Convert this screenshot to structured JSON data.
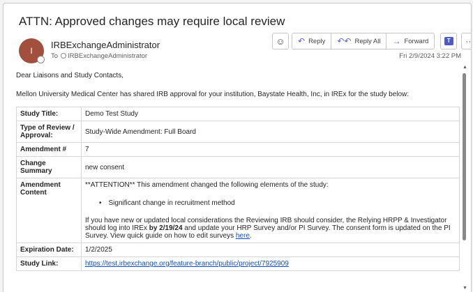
{
  "subject": "ATTN: Approved changes may require local review",
  "sender": {
    "avatar_letter": "I",
    "name": "IRBExchangeAdministrator",
    "to_label": "To",
    "to_name": "IRBExchangeAdministrator",
    "date": "Fri 2/9/2024 3:22 PM"
  },
  "actions": {
    "reply": "Reply",
    "reply_all": "Reply All",
    "forward": "Forward"
  },
  "body": {
    "greeting": "Dear Liaisons and Study Contacts,",
    "intro": "Mellon University Medical Center has shared IRB approval for your institution, Baystate Health, Inc, in IREx for the study below:"
  },
  "table": {
    "study_title_label": "Study Title:",
    "study_title": "Demo Test Study",
    "review_label": "Type of Review / Approval:",
    "review": "Study-Wide Amendment: Full Board",
    "amendment_label": "Amendment #",
    "amendment": "7",
    "summary_label": "Change Summary",
    "summary": "new consent",
    "content_label": "Amendment Content",
    "content_intro": "**ATTENTION** This amendment changed the following elements of the study:",
    "content_bullet": "Significant change in recruitment method",
    "content_p1": "If you have new or updated local considerations the Reviewing IRB should consider, the Relying HRPP & Investigator should log into IREx ",
    "content_bold": "by 2/19/24",
    "content_p2": " and update your HRP Survey and/or PI Survey. The consent form is updated on the PI Survey. View quick guide on how to edit surveys ",
    "content_link": "here",
    "content_end": ".",
    "expiration_label": "Expiration Date:",
    "expiration": "1/2/2025",
    "link_label": "Study Link:",
    "link": "https://test.irbexchange.org/feature-branch/public/project/7925909"
  },
  "colors": {
    "avatar": "#a34f3d",
    "accent": "#5b5fc7",
    "link": "#0f4fc9"
  },
  "icons": [
    "emoji-icon",
    "reply-icon",
    "reply-all-icon",
    "forward-icon",
    "teams-icon",
    "more-icon"
  ]
}
